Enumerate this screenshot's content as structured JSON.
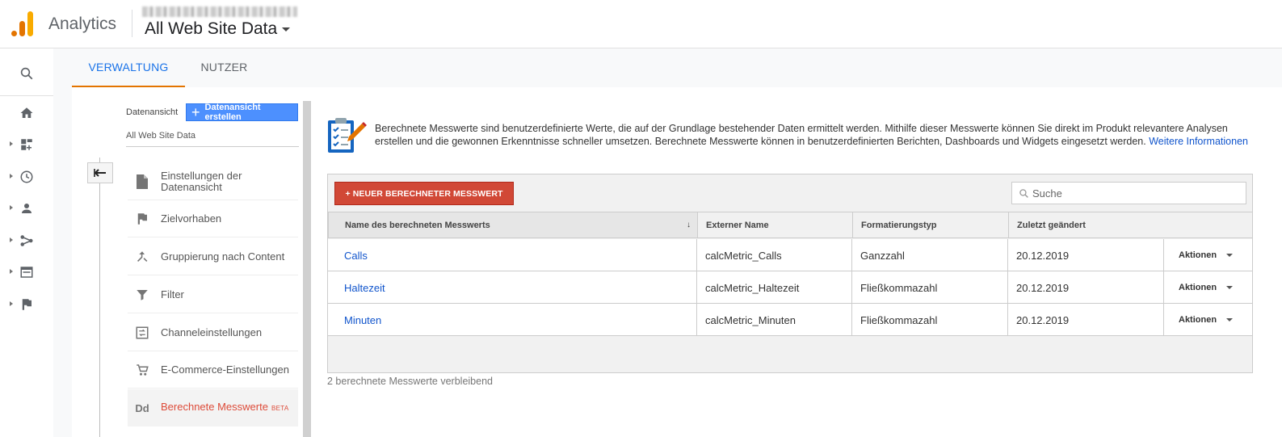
{
  "header": {
    "app_name": "Analytics",
    "property": "All Web Site Data",
    "icons": [
      "analytics-logo",
      "chevron-down-icon"
    ]
  },
  "leftnav": {
    "icons": [
      "search-icon",
      "home-icon",
      "dashboard-icon",
      "clock-icon",
      "person-icon",
      "acquisition-icon",
      "behavior-icon",
      "flag-icon"
    ]
  },
  "tabs": [
    {
      "label": "VERWALTUNG",
      "active": true
    },
    {
      "label": "NUTZER",
      "active": false
    }
  ],
  "view_panel": {
    "label": "Datenansicht",
    "create_button": "Datenansicht erstellen",
    "view_name": "All Web Site Data",
    "menu": [
      {
        "label": "Einstellungen der Datenansicht",
        "icon": "document-icon"
      },
      {
        "label": "Zielvorhaben",
        "icon": "flag-icon"
      },
      {
        "label": "Gruppierung nach Content",
        "icon": "merge-icon"
      },
      {
        "label": "Filter",
        "icon": "filter-icon"
      },
      {
        "label": "Channeleinstellungen",
        "icon": "channel-icon"
      },
      {
        "label": "E-Commerce-Einstellungen",
        "icon": "cart-icon"
      },
      {
        "label": "Berechnete Messwerte",
        "badge": "BETA",
        "icon_text": "Dd",
        "active": true
      }
    ]
  },
  "main": {
    "intro": "Berechnete Messwerte sind benutzerdefinierte Werte, die auf der Grundlage bestehender Daten ermittelt werden. Mithilfe dieser Messwerte können Sie direkt im Produkt relevantere Analysen erstellen und die gewonnen Erkenntnisse schneller umsetzen. Berechnete Messwerte können in benutzerdefinierten Berichten, Dashboards und Widgets eingesetzt werden.",
    "intro_link": "Weitere Informationen",
    "new_button": "+ NEUER BERECHNETER MESSWERT",
    "search_placeholder": "Suche",
    "columns": [
      "Name des berechneten Messwerts",
      "Externer Name",
      "Formatierungstyp",
      "Zuletzt geändert"
    ],
    "rows": [
      {
        "name": "Calls",
        "external": "calcMetric_Calls",
        "format": "Ganzzahl",
        "modified": "20.12.2019",
        "action": "Aktionen"
      },
      {
        "name": "Haltezeit",
        "external": "calcMetric_Haltezeit",
        "format": "Fließkommazahl",
        "modified": "20.12.2019",
        "action": "Aktionen"
      },
      {
        "name": "Minuten",
        "external": "calcMetric_Minuten",
        "format": "Fließkommazahl",
        "modified": "20.12.2019",
        "action": "Aktionen"
      }
    ],
    "remaining": "2 berechnete Messwerte verbleibend"
  },
  "colors": {
    "accent_blue": "#1a73e8",
    "brand_orange": "#e37400",
    "red_button": "#d14836",
    "link_blue": "#1155cc"
  }
}
